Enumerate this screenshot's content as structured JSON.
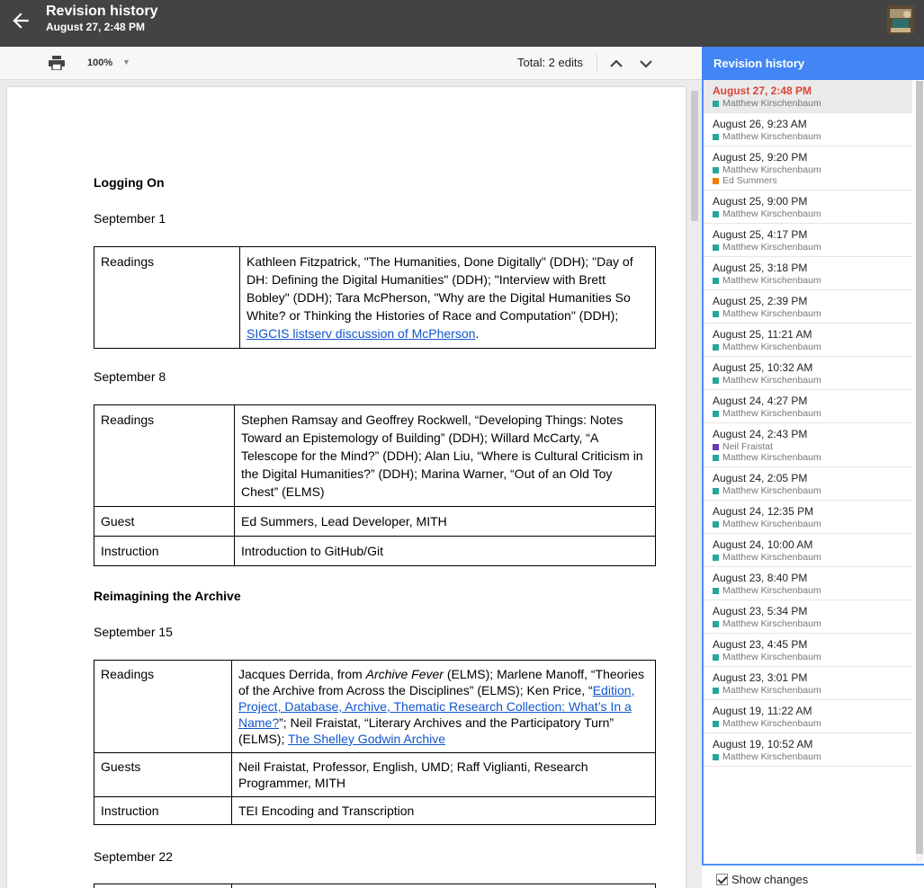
{
  "header": {
    "title": "Revision history",
    "subtitle": "August 27, 2:48 PM"
  },
  "toolbar": {
    "zoom": "100%",
    "total_edits": "Total: 2 edits"
  },
  "document": {
    "heading1": "Logging On",
    "date1": "September 1",
    "table1": {
      "r1_label": "Readings",
      "r1_text": "Kathleen Fitzpatrick, \"The Humanities, Done Digitally\" (DDH); \"Day of DH: Defining the Digital Humanities\" (DDH); \"Interview with Brett Bobley\" (DDH);  Tara McPherson, \"Why are the Digital Humanities So White? or Thinking the Histories of Race and Computation\" (DDH); ",
      "r1_link": "SIGCIS listserv discussion of McPherson",
      "r1_end": "."
    },
    "date2": "September 8",
    "table2": {
      "r1_label": "Readings",
      "r1_text": "Stephen Ramsay and Geoffrey Rockwell, “Developing Things: Notes Toward an Epistemology of Building” (DDH); Willard McCarty, “A Telescope for the Mind?” (DDH); Alan Liu, “Where is Cultural Criticism in the Digital Humanities?” (DDH); Marina Warner, “Out of an Old Toy Chest” (ELMS)",
      "r2_label": "Guest",
      "r2_text": "Ed Summers, Lead Developer, MITH",
      "r3_label": "Instruction",
      "r3_text": "Introduction to GitHub/Git"
    },
    "heading2": "Reimagining the Archive",
    "date3": "September 15",
    "table3": {
      "r1_label": "Readings",
      "r1_a": "Jacques Derrida, from ",
      "r1_em": "Archive Fever",
      "r1_b": " (ELMS); Marlene Manoff, “Theories of the Archive from Across the Disciplines” (ELMS); Ken Price, “",
      "r1_link1": "Edition, Project, Database, Archive, Thematic Research Collection: What’s In a Name?",
      "r1_c": "”; Neil Fraistat, “Literary Archives and the Participatory Turn” (ELMS); ",
      "r1_link2": "The Shelley Godwin Archive",
      "r2_label": "Guests",
      "r2_text": "Neil Fraistat, Professor, English, UMD; Raff Viglianti, Research Programmer, MITH",
      "r3_label": "Instruction",
      "r3_text": "TEI Encoding and Transcription"
    },
    "date4": "September 22"
  },
  "revision_panel": {
    "title": "Revision history",
    "show_changes": "Show changes",
    "colors": {
      "matthew": "#26a69a",
      "ed": "#f57c00",
      "neil": "#673ab7",
      "selected_time": "#db4437",
      "header": "#4285f4"
    },
    "items": [
      {
        "time": "August 27, 2:48 PM",
        "authors": [
          "Matthew Kirschenbaum"
        ],
        "selected": true
      },
      {
        "time": "August 26, 9:23 AM",
        "authors": [
          "Matthew Kirschenbaum"
        ]
      },
      {
        "time": "August 25, 9:20 PM",
        "authors": [
          "Matthew Kirschenbaum",
          "Ed Summers"
        ]
      },
      {
        "time": "August 25, 9:00 PM",
        "authors": [
          "Matthew Kirschenbaum"
        ]
      },
      {
        "time": "August 25, 4:17 PM",
        "authors": [
          "Matthew Kirschenbaum"
        ]
      },
      {
        "time": "August 25, 3:18 PM",
        "authors": [
          "Matthew Kirschenbaum"
        ]
      },
      {
        "time": "August 25, 2:39 PM",
        "authors": [
          "Matthew Kirschenbaum"
        ]
      },
      {
        "time": "August 25, 11:21 AM",
        "authors": [
          "Matthew Kirschenbaum"
        ]
      },
      {
        "time": "August 25, 10:32 AM",
        "authors": [
          "Matthew Kirschenbaum"
        ]
      },
      {
        "time": "August 24, 4:27 PM",
        "authors": [
          "Matthew Kirschenbaum"
        ]
      },
      {
        "time": "August 24, 2:43 PM",
        "authors": [
          "Neil Fraistat",
          "Matthew Kirschenbaum"
        ]
      },
      {
        "time": "August 24, 2:05 PM",
        "authors": [
          "Matthew Kirschenbaum"
        ]
      },
      {
        "time": "August 24, 12:35 PM",
        "authors": [
          "Matthew Kirschenbaum"
        ]
      },
      {
        "time": "August 24, 10:00 AM",
        "authors": [
          "Matthew Kirschenbaum"
        ]
      },
      {
        "time": "August 23, 8:40 PM",
        "authors": [
          "Matthew Kirschenbaum"
        ]
      },
      {
        "time": "August 23, 5:34 PM",
        "authors": [
          "Matthew Kirschenbaum"
        ]
      },
      {
        "time": "August 23, 4:45 PM",
        "authors": [
          "Matthew Kirschenbaum"
        ]
      },
      {
        "time": "August 23, 3:01 PM",
        "authors": [
          "Matthew Kirschenbaum"
        ]
      },
      {
        "time": "August 19, 11:22 AM",
        "authors": [
          "Matthew Kirschenbaum"
        ]
      },
      {
        "time": "August 19, 10:52 AM",
        "authors": [
          "Matthew Kirschenbaum"
        ]
      }
    ]
  }
}
